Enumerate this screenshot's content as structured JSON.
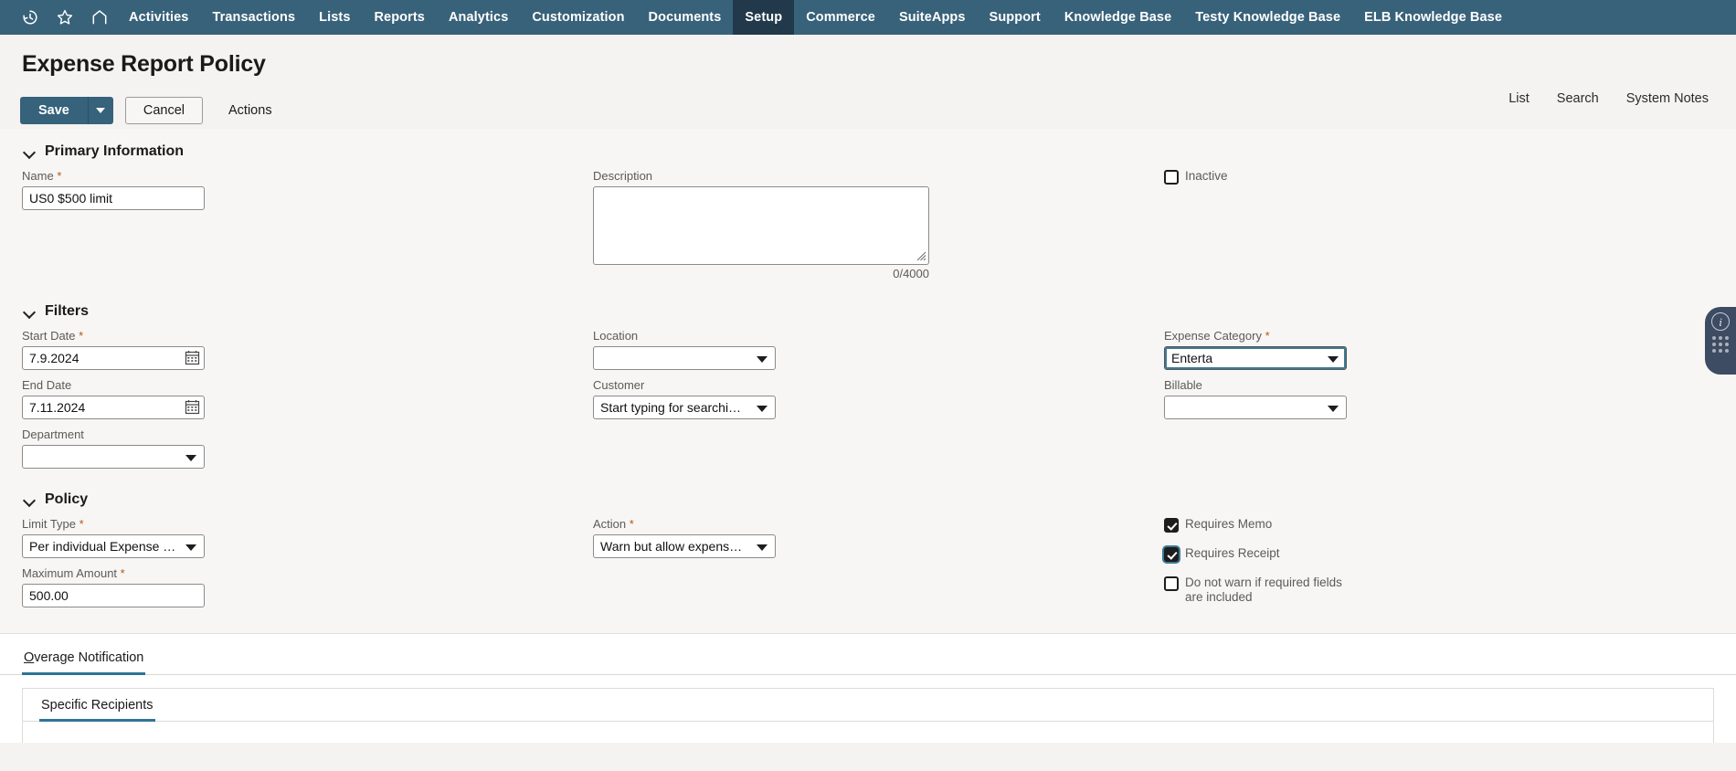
{
  "nav": {
    "icons": [
      {
        "name": "recent-history-icon",
        "label": "Recent Records"
      },
      {
        "name": "favorites-star-icon",
        "label": "Shortcuts"
      },
      {
        "name": "home-icon",
        "label": "Home"
      }
    ],
    "items": [
      {
        "label": "Activities",
        "active": false
      },
      {
        "label": "Transactions",
        "active": false
      },
      {
        "label": "Lists",
        "active": false
      },
      {
        "label": "Reports",
        "active": false
      },
      {
        "label": "Analytics",
        "active": false
      },
      {
        "label": "Customization",
        "active": false
      },
      {
        "label": "Documents",
        "active": false
      },
      {
        "label": "Setup",
        "active": true
      },
      {
        "label": "Commerce",
        "active": false
      },
      {
        "label": "SuiteApps",
        "active": false
      },
      {
        "label": "Support",
        "active": false
      },
      {
        "label": "Knowledge Base",
        "active": false
      },
      {
        "label": "Testy Knowledge Base",
        "active": false
      },
      {
        "label": "ELB Knowledge Base",
        "active": false
      }
    ],
    "bg_color": "#38627a",
    "active_bg_color": "#21394a"
  },
  "header": {
    "title": "Expense Report Policy",
    "links": [
      {
        "label": "List"
      },
      {
        "label": "Search"
      },
      {
        "label": "System Notes"
      }
    ]
  },
  "toolbar": {
    "save_label": "Save",
    "save_color": "#36627b",
    "cancel_label": "Cancel",
    "actions_label": "Actions"
  },
  "sections": {
    "primary": {
      "title": "Primary Information",
      "name_label": "Name",
      "name_required": "*",
      "name_value": "US0 $500 limit",
      "description_label": "Description",
      "description_value": "",
      "description_counter": "0/4000",
      "inactive_label": "Inactive",
      "inactive_checked": false
    },
    "filters": {
      "title": "Filters",
      "start_date_label": "Start Date",
      "start_date_required": "*",
      "start_date_value": "7.9.2024",
      "end_date_label": "End Date",
      "end_date_value": "7.11.2024",
      "department_label": "Department",
      "department_value": "",
      "location_label": "Location",
      "location_value": "",
      "customer_label": "Customer",
      "customer_value": "Start typing for searchi…",
      "expense_category_label": "Expense Category",
      "expense_category_required": "*",
      "expense_category_value": "Enterta",
      "billable_label": "Billable",
      "billable_value": ""
    },
    "policy": {
      "title": "Policy",
      "limit_type_label": "Limit Type",
      "limit_type_required": "*",
      "limit_type_value": "Per individual Expense …",
      "maximum_amount_label": "Maximum Amount",
      "maximum_amount_required": "*",
      "maximum_amount_value": "500.00",
      "action_label": "Action",
      "action_required": "*",
      "action_value": "Warn but allow expens…",
      "requires_memo_label": "Requires Memo",
      "requires_memo_checked": true,
      "requires_receipt_label": "Requires Receipt",
      "requires_receipt_checked": true,
      "do_not_warn_label": "Do not warn if required fields are included",
      "do_not_warn_checked": false
    }
  },
  "tabs": {
    "accent_color": "#2e7496",
    "main": [
      {
        "label": "Overage Notification",
        "accesskey": "O",
        "active": true
      }
    ],
    "sub": [
      {
        "label": "Specific Recipients",
        "accesskey": "S",
        "active": true
      }
    ]
  },
  "float_widget": {
    "info_glyph": "i",
    "bg_color": "#3d4c63"
  }
}
